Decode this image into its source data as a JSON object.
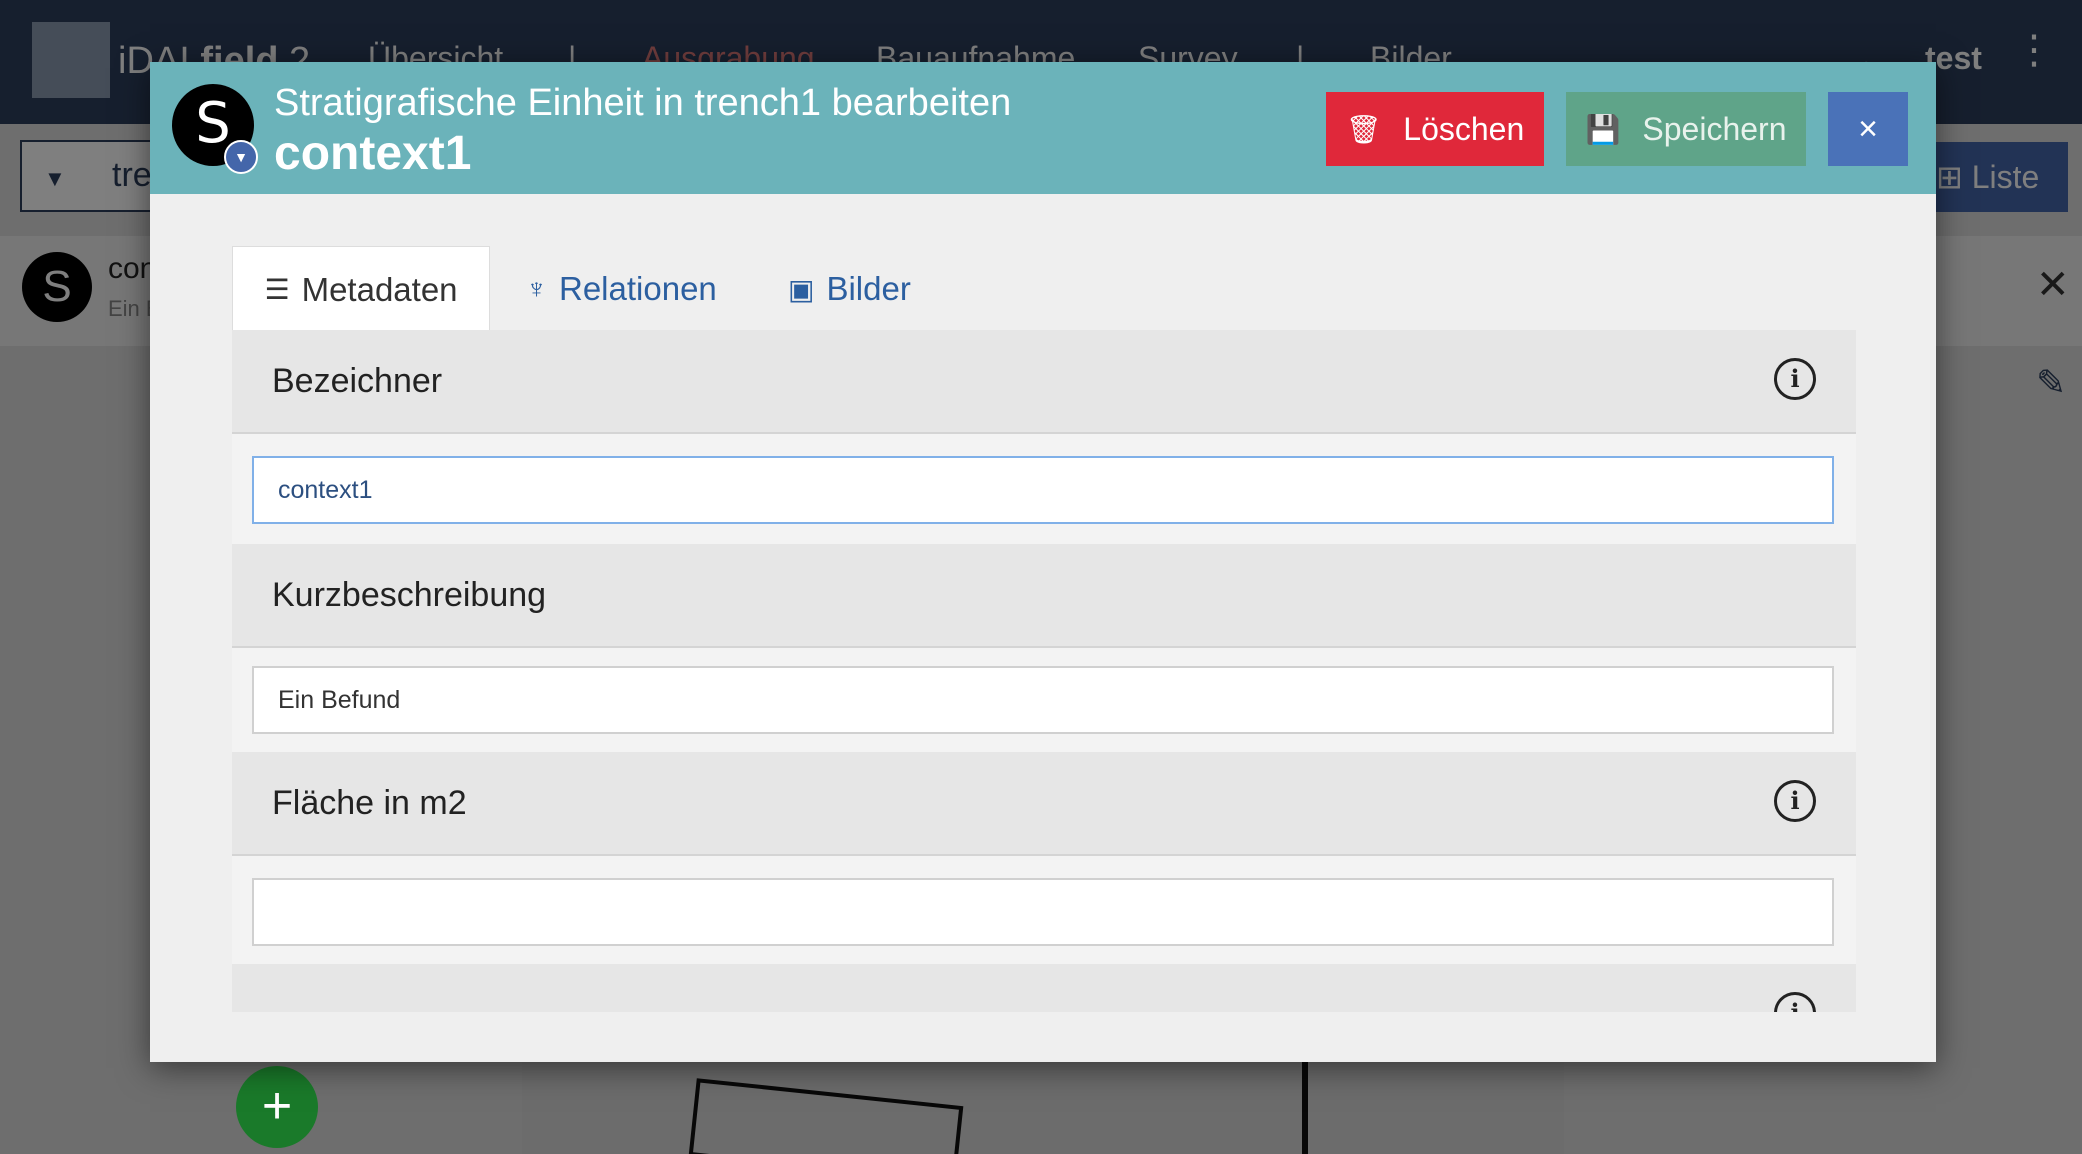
{
  "app": {
    "logo_prefix": "iDAI",
    "logo_main": "field",
    "logo_version": "2",
    "nav_items": [
      "Übersicht",
      "Ausgrabung",
      "Bauaufnahme",
      "Survey",
      "Bilder"
    ],
    "user": "test",
    "search_value": "tre",
    "list_label": "Liste",
    "list_row_title": "con",
    "list_row_subtitle": "Ein B",
    "avatar_letter": "S"
  },
  "modal": {
    "subtitle": "Stratigrafische Einheit in trench1 bearbeiten",
    "title": "context1",
    "avatar_letter": "S",
    "buttons": {
      "delete": "Löschen",
      "save": "Speichern",
      "close": "×"
    },
    "tabs": [
      {
        "label": "Metadaten",
        "icon": "list-icon"
      },
      {
        "label": "Relationen",
        "icon": "hierarchy-icon"
      },
      {
        "label": "Bilder",
        "icon": "image-icon"
      }
    ],
    "fields": [
      {
        "label": "Bezeichner",
        "value": "context1",
        "has_info": true
      },
      {
        "label": "Kurzbeschreibung",
        "value": "Ein Befund",
        "has_info": false
      },
      {
        "label": "Fläche in m2",
        "value": "",
        "has_info": true
      }
    ]
  },
  "colors": {
    "header": "#6bb3ba",
    "delete": "#e0283a",
    "save": "#5fa489",
    "close": "#4a72b8",
    "navbar": "#2c3e5c"
  }
}
